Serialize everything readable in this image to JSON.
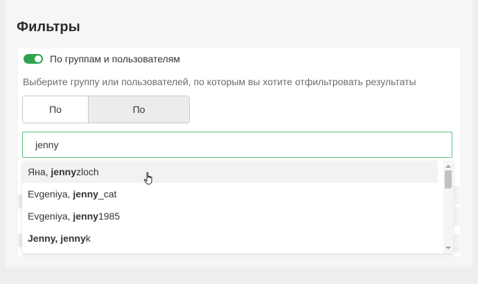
{
  "filters": {
    "title": "Фильтры",
    "toggle_label": "По группам и пользователям",
    "toggle_on": true,
    "hint": "Выберите группу или пользователей, по которым вы хотите отфильтровать результаты",
    "segments": [
      "По группе",
      "По пользователям"
    ],
    "active_segment": "По пользователям",
    "search_value": "jenny"
  },
  "dropdown": {
    "items": [
      {
        "pre": "Яна, ",
        "match": "jenny",
        "post": "zloch"
      },
      {
        "pre": "Evgeniya, ",
        "match": "jenny",
        "post": "_cat"
      },
      {
        "pre": "Evgeniya, ",
        "match": "jenny",
        "post": "1985"
      },
      {
        "pre": "",
        "match": "Jenny, jenny",
        "post": "k"
      }
    ]
  },
  "colors": {
    "accent": "#2ea44f",
    "search_border": "#55c07a"
  },
  "icons": {
    "cursor": "hand-pointer"
  }
}
